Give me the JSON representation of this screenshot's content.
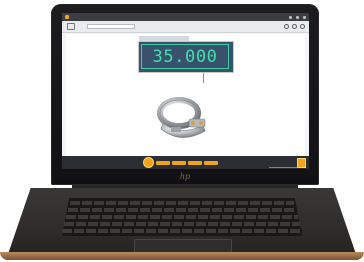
{
  "measurement": {
    "value": "35.000"
  },
  "colors": {
    "accent": "#f2a516",
    "readout": "#3ee0ae",
    "panel": "#39516a",
    "connector": "#3fa3e0"
  }
}
